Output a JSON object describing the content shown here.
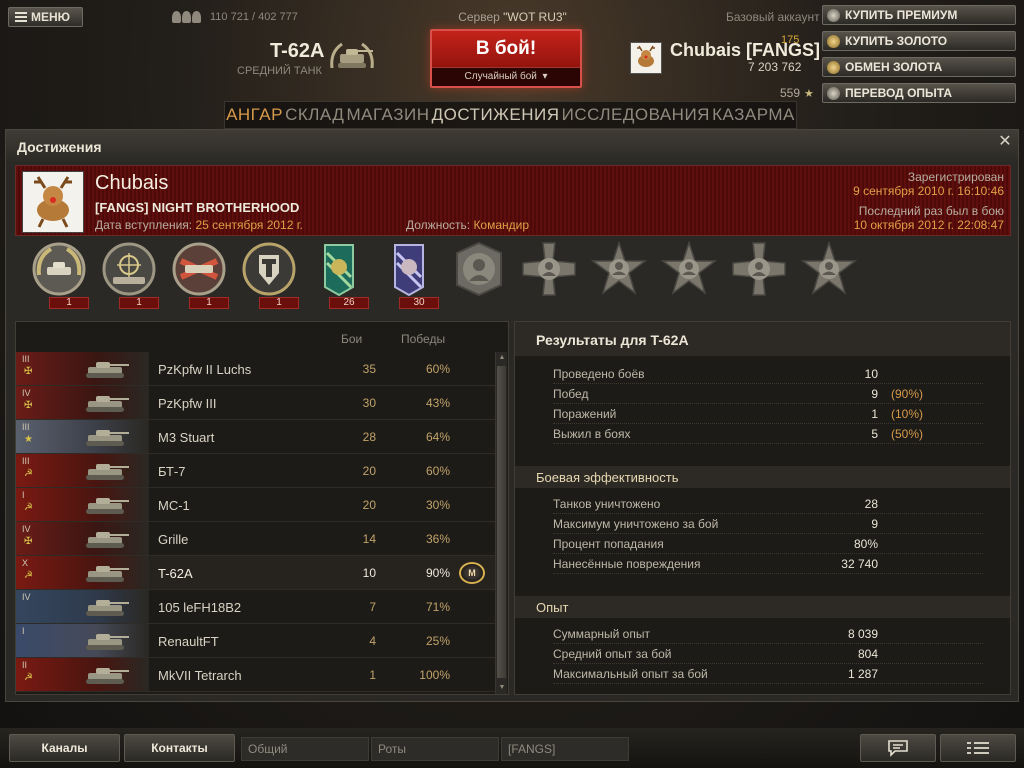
{
  "topbar": {
    "menu_label": "МЕНЮ",
    "online_count": "110 721 / 402 777",
    "server_prefix": "Сервер",
    "server_name": "\"WOT RU3\"",
    "tank_name": "T-62A",
    "tank_class": "СРЕДНИЙ ТАНК",
    "battle_label": "В бой!",
    "battle_mode": "Случайный бой",
    "account_type": "Базовый аккаунт",
    "player_name": "Chubais [FANGS]",
    "gold": "175",
    "credits": "7 203 762",
    "free_xp": "559",
    "buttons": [
      "КУПИТЬ ПРЕМИУМ",
      "КУПИТЬ ЗОЛОТО",
      "ОБМЕН ЗОЛОТА",
      "ПЕРЕВОД ОПЫТА"
    ]
  },
  "nav": {
    "items": [
      "АНГАР",
      "СКЛАД",
      "МАГАЗИН",
      "ДОСТИЖЕНИЯ",
      "ИССЛЕДОВАНИЯ",
      "КАЗАРМА"
    ],
    "active": "ДОСТИЖЕНИЯ"
  },
  "window": {
    "title": "Достижения",
    "close_glyph": "✕"
  },
  "profile": {
    "name": "Chubais",
    "clan": "[FANGS] NIGHT BROTHERHOOD",
    "join_label": "Дата вступления:",
    "join_date": "25 сентября 2012 г.",
    "role_label": "Должность:",
    "role": "Командир",
    "reg_label": "Зарегистрирован",
    "reg_date": "9 сентября 2010 г. 16:10:46",
    "last_label": "Последний раз был в бою",
    "last_date": "10 октября 2012 г. 22:08:47"
  },
  "medals": [
    {
      "name": "medal-tank-wreath",
      "count": "1"
    },
    {
      "name": "medal-sniper",
      "count": "1"
    },
    {
      "name": "medal-double-tank",
      "count": "1"
    },
    {
      "name": "medal-shield-emblem",
      "count": "1"
    },
    {
      "name": "medal-green-ribbon",
      "count": "26"
    },
    {
      "name": "medal-blue-ribbon",
      "count": "30"
    },
    {
      "name": "medal-portrait-1",
      "count": ""
    },
    {
      "name": "medal-cross-1",
      "count": ""
    },
    {
      "name": "medal-star-1",
      "count": ""
    },
    {
      "name": "medal-star-2",
      "count": ""
    },
    {
      "name": "medal-cross-2",
      "count": ""
    },
    {
      "name": "medal-star-3",
      "count": ""
    }
  ],
  "vehicles": {
    "headers": {
      "battles": "Бои",
      "wins": "Победы"
    },
    "rows": [
      {
        "tier": "III",
        "nation": "de",
        "sym": "✠",
        "name": "PzKpfw II Luchs",
        "battles": "35",
        "wins": "60%",
        "mastery": ""
      },
      {
        "tier": "IV",
        "nation": "de",
        "sym": "✠",
        "name": "PzKpfw III",
        "battles": "30",
        "wins": "43%",
        "mastery": ""
      },
      {
        "tier": "III",
        "nation": "us",
        "sym": "★",
        "name": "M3 Stuart",
        "battles": "28",
        "wins": "64%",
        "mastery": ""
      },
      {
        "tier": "III",
        "nation": "su",
        "sym": "☭",
        "name": "БТ-7",
        "battles": "20",
        "wins": "60%",
        "mastery": ""
      },
      {
        "tier": "I",
        "nation": "su",
        "sym": "☭",
        "name": "МС-1",
        "battles": "20",
        "wins": "30%",
        "mastery": ""
      },
      {
        "tier": "IV",
        "nation": "de",
        "sym": "✠",
        "name": "Grille",
        "battles": "14",
        "wins": "36%",
        "mastery": ""
      },
      {
        "tier": "X",
        "nation": "su",
        "sym": "☭",
        "name": "T-62A",
        "battles": "10",
        "wins": "90%",
        "mastery": "M"
      },
      {
        "tier": "IV",
        "nation": "uk",
        "sym": "",
        "name": "105 leFH18B2",
        "battles": "7",
        "wins": "71%",
        "mastery": ""
      },
      {
        "tier": "I",
        "nation": "fr",
        "sym": "",
        "name": "RenaultFT",
        "battles": "4",
        "wins": "25%",
        "mastery": ""
      },
      {
        "tier": "II",
        "nation": "su",
        "sym": "☭",
        "name": "MkVII Tetrarch",
        "battles": "1",
        "wins": "100%",
        "mastery": ""
      }
    ],
    "selected_index": 6
  },
  "results": {
    "title": "Результаты для T-62A",
    "general": [
      {
        "label": "Проведено боёв",
        "value": "10",
        "pct": ""
      },
      {
        "label": "Побед",
        "value": "9",
        "pct": "(90%)"
      },
      {
        "label": "Поражений",
        "value": "1",
        "pct": "(10%)"
      },
      {
        "label": "Выжил в боях",
        "value": "5",
        "pct": "(50%)"
      }
    ],
    "efficiency_title": "Боевая эффективность",
    "efficiency": [
      {
        "label": "Танков уничтожено",
        "value": "28"
      },
      {
        "label": "Максимум уничтожено за бой",
        "value": "9"
      },
      {
        "label": "Процент попадания",
        "value": "80%"
      },
      {
        "label": "Нанесённые повреждения",
        "value": "32 740"
      }
    ],
    "xp_title": "Опыт",
    "xp": [
      {
        "label": "Суммарный опыт",
        "value": "8 039"
      },
      {
        "label": "Средний опыт за бой",
        "value": "804"
      },
      {
        "label": "Максимальный опыт за бой",
        "value": "1 287"
      }
    ]
  },
  "bottombar": {
    "channels": "Каналы",
    "contacts": "Контакты",
    "tabs": [
      "Общий",
      "Роты",
      "[FANGS]"
    ]
  },
  "colors": {
    "accent_orange": "#d79a4a",
    "battle_red": "#c3231a",
    "profile_red": "#5e0e0c"
  }
}
